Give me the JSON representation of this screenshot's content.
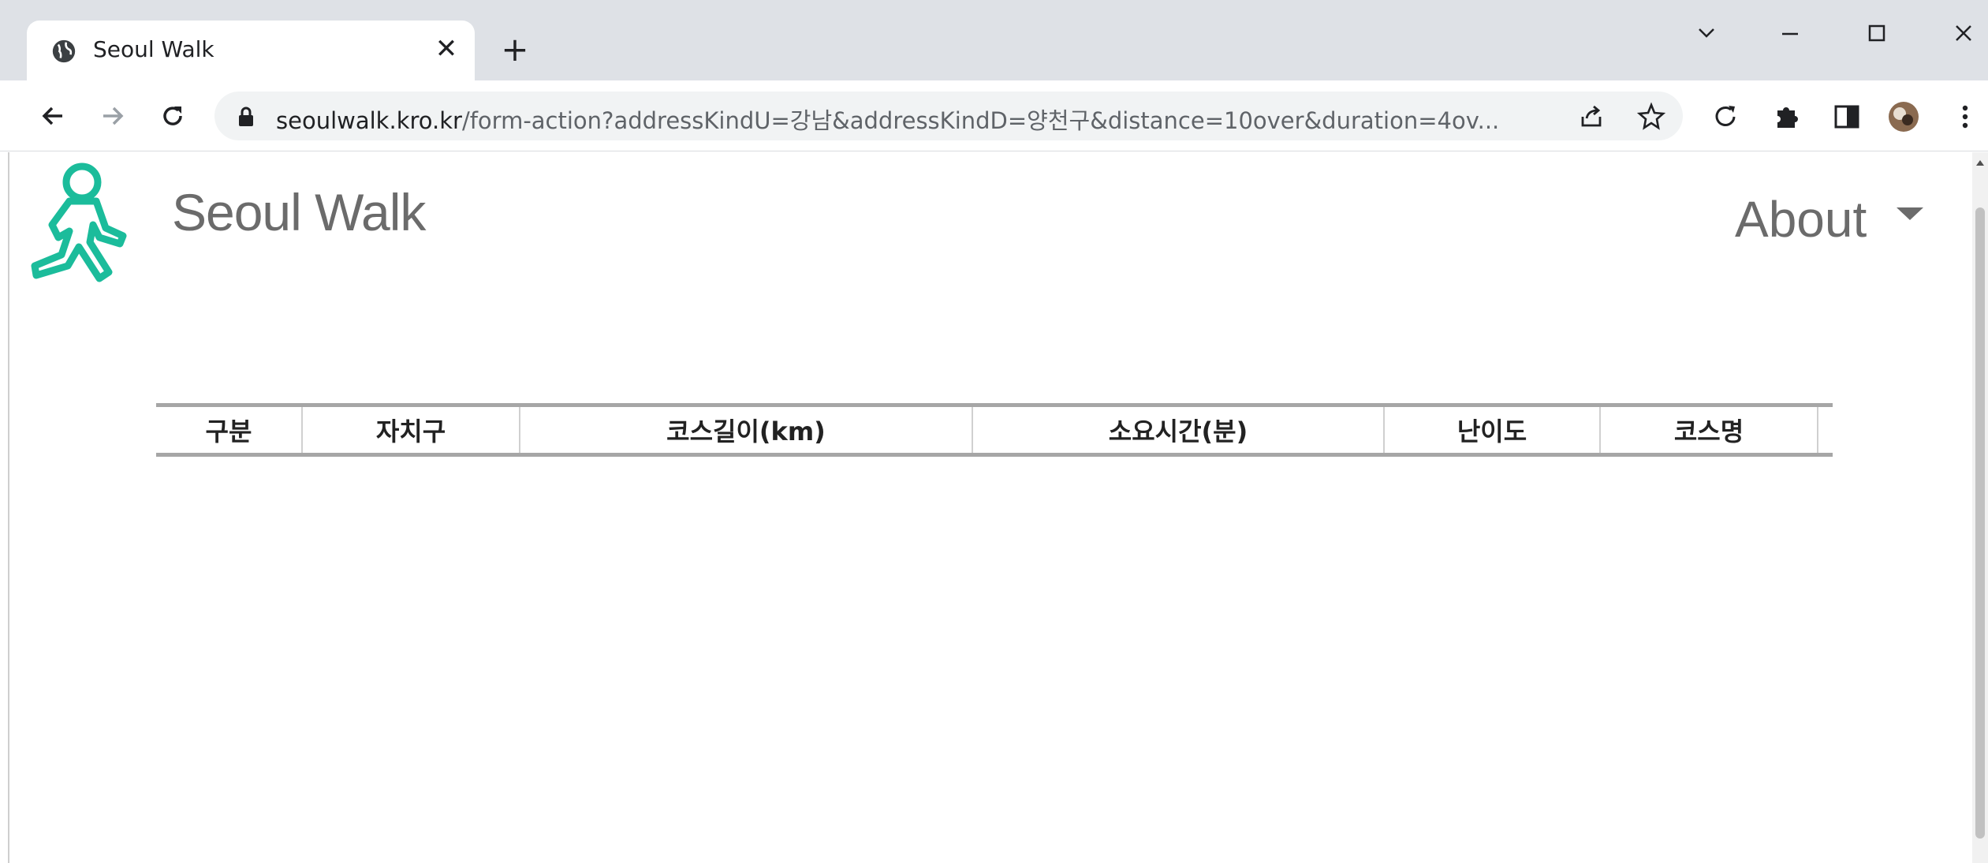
{
  "browser": {
    "tab_title": "Seoul Walk",
    "url_host": "seoulwalk.kro.kr",
    "url_path": "/form-action?addressKindU=강남&addressKindD=양천구&distance=10over&duration=4ov..."
  },
  "site": {
    "brand": "Seoul Walk",
    "logo_icon": "walking-person-icon",
    "accent_color": "#1bbc9b",
    "nav_about": "About"
  },
  "table": {
    "headers": [
      "구분",
      "자치구",
      "코스길이(km)",
      "소요시간(분)",
      "난이도",
      "코스명"
    ],
    "rows": []
  }
}
